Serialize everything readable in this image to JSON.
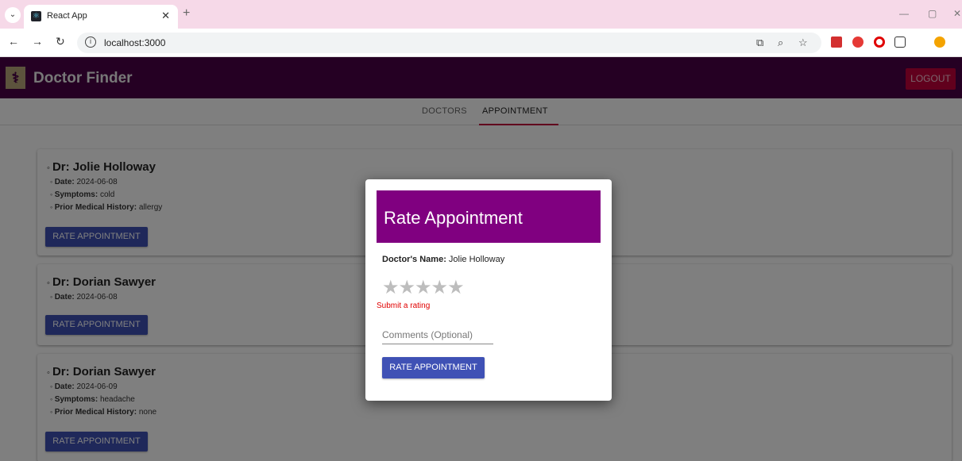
{
  "browser": {
    "tab_title": "React App",
    "url": "localhost:3000"
  },
  "app": {
    "title": "Doctor Finder",
    "logout_label": "LOGOUT",
    "tabs": [
      {
        "label": "DOCTORS",
        "active": false
      },
      {
        "label": "APPOINTMENT",
        "active": true
      }
    ]
  },
  "appointments": [
    {
      "doctor": "Dr: Jolie Holloway",
      "date_label": "Date:",
      "date": "2024-06-08",
      "symptoms_label": "Symptoms:",
      "symptoms": "cold",
      "history_label": "Prior Medical History:",
      "history": "allergy",
      "button_label": "RATE APPOINTMENT"
    },
    {
      "doctor": "Dr: Dorian Sawyer",
      "date_label": "Date:",
      "date": "2024-06-08",
      "button_label": "RATE APPOINTMENT"
    },
    {
      "doctor": "Dr: Dorian Sawyer",
      "date_label": "Date:",
      "date": "2024-06-09",
      "symptoms_label": "Symptoms:",
      "symptoms": "headache",
      "history_label": "Prior Medical History:",
      "history": "none",
      "button_label": "RATE APPOINTMENT"
    }
  ],
  "modal": {
    "title": "Rate Appointment",
    "doctor_label": "Doctor's Name:",
    "doctor_name": "Jolie Holloway",
    "rating": 0,
    "rating_max": 5,
    "stars": "★★★★★",
    "error": "Submit a rating",
    "comments_placeholder": "Comments (Optional)",
    "submit_label": "RATE APPOINTMENT"
  },
  "colors": {
    "appbar": "#4a0046",
    "modal_header": "#800080",
    "primary_button": "#3f51b5",
    "logout_button": "#c2003a",
    "error": "#e00000"
  }
}
